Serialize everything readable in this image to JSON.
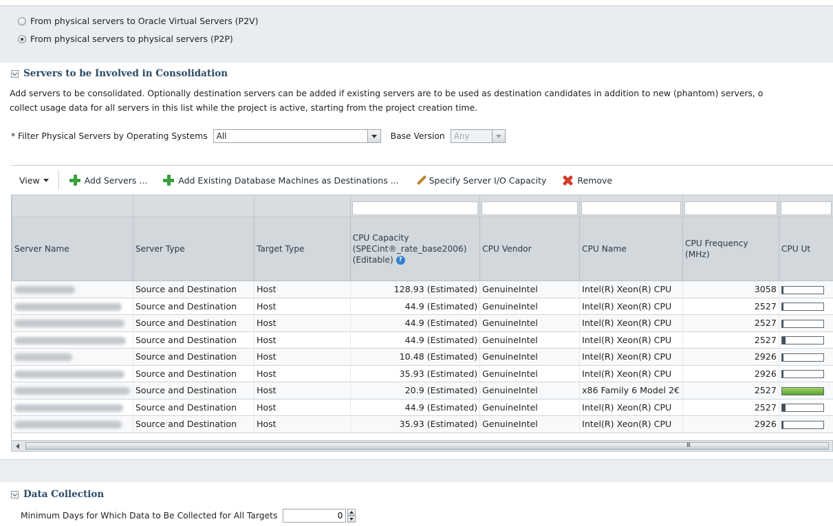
{
  "conversion": {
    "options": [
      {
        "label": "From physical servers to Oracle Virtual Servers (P2V)",
        "selected": false
      },
      {
        "label": "From physical servers to physical servers (P2P)",
        "selected": true
      }
    ]
  },
  "servers_section": {
    "title": "Servers to be Involved in Consolidation",
    "description_line1": "Add servers to be consolidated. Optionally destination servers can be added if existing servers are to be used as destination candidates in addition to new (phantom) servers, o",
    "description_line2": "collect usage data for all servers in this list while the project is active, starting from the project creation time.",
    "filter_label": "* Filter Physical Servers by Operating Systems",
    "filter_value": "All",
    "base_version_label": "Base Version",
    "base_version_value": "Any"
  },
  "toolbar": {
    "view_label": "View",
    "add_servers_label": "Add Servers ...",
    "add_existing_label": "Add Existing Database Machines as Destinations ...",
    "specify_io_label": "Specify Server I/O Capacity",
    "remove_label": "Remove"
  },
  "table": {
    "headers": {
      "server_name": "Server Name",
      "server_type": "Server Type",
      "target_type": "Target Type",
      "cpu_capacity_1": "CPU Capacity",
      "cpu_capacity_2": "(SPECint®_rate_base2006)",
      "cpu_capacity_3": "(Editable)",
      "cpu_vendor": "CPU Vendor",
      "cpu_name": "CPU Name",
      "cpu_frequency_1": "CPU Frequency",
      "cpu_frequency_2": "(MHz)",
      "cpu_util": "CPU Ut"
    },
    "rows": [
      {
        "type": "Source and Destination",
        "target": "Host",
        "capacity": "128.93 (Estimated)",
        "vendor": "GenuineIntel",
        "cpu_name": "Intel(R) Xeon(R) CPU",
        "freq": "3058",
        "util": 0.03
      },
      {
        "type": "Source and Destination",
        "target": "Host",
        "capacity": "44.9 (Estimated)",
        "vendor": "GenuineIntel",
        "cpu_name": "Intel(R) Xeon(R) CPU",
        "freq": "2527",
        "util": 0.01
      },
      {
        "type": "Source and Destination",
        "target": "Host",
        "capacity": "44.9 (Estimated)",
        "vendor": "GenuineIntel",
        "cpu_name": "Intel(R) Xeon(R) CPU",
        "freq": "2527",
        "util": 0.01
      },
      {
        "type": "Source and Destination",
        "target": "Host",
        "capacity": "44.9 (Estimated)",
        "vendor": "GenuineIntel",
        "cpu_name": "Intel(R) Xeon(R) CPU",
        "freq": "2527",
        "util": 0.08
      },
      {
        "type": "Source and Destination",
        "target": "Host",
        "capacity": "10.48 (Estimated)",
        "vendor": "GenuineIntel",
        "cpu_name": "Intel(R) Xeon(R) CPU",
        "freq": "2926",
        "util": 0.01
      },
      {
        "type": "Source and Destination",
        "target": "Host",
        "capacity": "35.93 (Estimated)",
        "vendor": "GenuineIntel",
        "cpu_name": "Intel(R) Xeon(R) CPU",
        "freq": "2926",
        "util": 0.04
      },
      {
        "type": "Source and Destination",
        "target": "Host",
        "capacity": "20.9 (Estimated)",
        "vendor": "GenuineIntel",
        "cpu_name": "x86 Family 6 Model 2€",
        "freq": "2527",
        "util": 1.0,
        "util_color": "#5aa52e"
      },
      {
        "type": "Source and Destination",
        "target": "Host",
        "capacity": "44.9 (Estimated)",
        "vendor": "GenuineIntel",
        "cpu_name": "Intel(R) Xeon(R) CPU",
        "freq": "2527",
        "util": 0.09
      },
      {
        "type": "Source and Destination",
        "target": "Host",
        "capacity": "35.93 (Estimated)",
        "vendor": "GenuineIntel",
        "cpu_name": "Intel(R) Xeon(R) CPU",
        "freq": "2926",
        "util": 0.03
      }
    ],
    "scroll_grip": "III"
  },
  "data_collection": {
    "title": "Data Collection",
    "min_days_label": "Minimum Days for Which Data to Be Collected for All Targets",
    "min_days_value": "0"
  }
}
